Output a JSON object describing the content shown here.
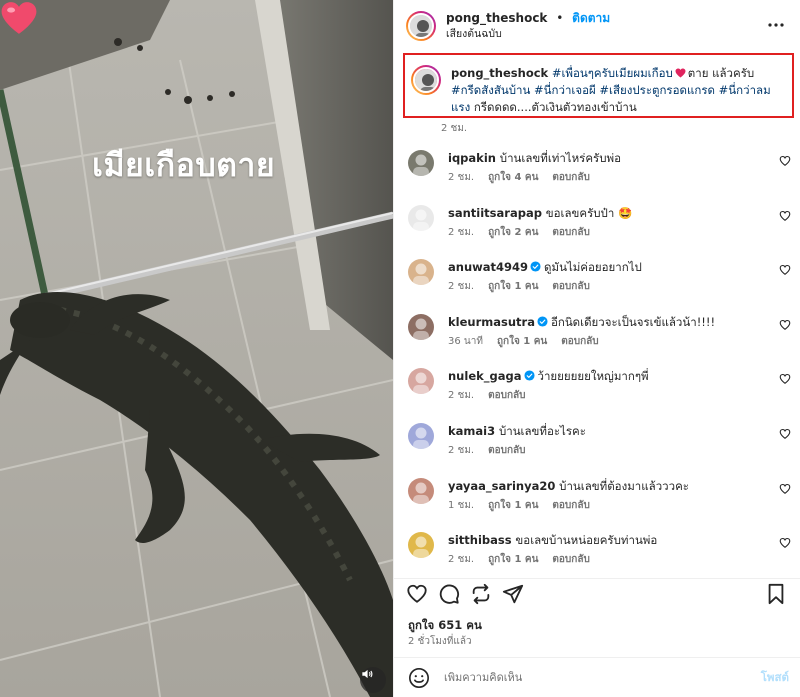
{
  "media": {
    "overlay_text": "เมียเกือบตาย",
    "overlay_emoji": "heart-emoji",
    "sound_icon": "speaker-icon"
  },
  "header": {
    "username": "pong_theshock",
    "separator": "•",
    "follow_label": "ติดตาม",
    "audio_label": "เสียงต้นฉบับ",
    "more_icon": "more-horizontal-icon"
  },
  "caption": {
    "username": "pong_theshock",
    "tag1": "#เพื่อนๆครับเมียผมเกือบ",
    "text1": "ตาย แล้วครับ",
    "tag2": "#กรีดสังสันบ้าน",
    "tag3": "#นี่กว่าเจอผี",
    "tag4": "#เสียงประตูกรอดแกรด",
    "tag5": "#นี่กว่าลมแรง",
    "text2": "กรีดดดด....ตัวเงินตัวทองเข้าบ้าน",
    "time": "2 ชม."
  },
  "comments": [
    {
      "username": "iqpakin",
      "text": "บ้านเลขที่เท่าไหร่ครับพ่อ",
      "verified": false,
      "time": "2 ชม.",
      "likes": "ถูกใจ 4 คน",
      "reply": "ตอบกลับ",
      "avatar_color": "#7a7a6e"
    },
    {
      "username": "santiitsarapap",
      "text": "ขอเลขครับป๋า 🤩",
      "verified": false,
      "time": "2 ชม.",
      "likes": "ถูกใจ 2 คน",
      "reply": "ตอบกลับ",
      "avatar_color": "#e9e9e9"
    },
    {
      "username": "anuwat4949",
      "text": "ดูมันไม่ค่อยอยากไป",
      "verified": true,
      "time": "2 ชม.",
      "likes": "ถูกใจ 1 คน",
      "reply": "ตอบกลับ",
      "avatar_color": "#d9b38c"
    },
    {
      "username": "kleurmasutra",
      "text": "อีกนิดเดียวจะเป็นจรเข้แล้วน้า!!!!",
      "verified": true,
      "time": "36 นาที",
      "likes": "ถูกใจ 1 คน",
      "reply": "ตอบกลับ",
      "avatar_color": "#8d6e63"
    },
    {
      "username": "nulek_gaga",
      "text": "ว้ายยยยยยใหญ่มากๆพี่",
      "verified": true,
      "time": "2 ชม.",
      "likes": "",
      "reply": "ตอบกลับ",
      "avatar_color": "#d7a7a0"
    },
    {
      "username": "kamai3",
      "text": "บ้านเลขที่อะไรคะ",
      "verified": false,
      "time": "2 ชม.",
      "likes": "",
      "reply": "ตอบกลับ",
      "avatar_color": "#9fa8da"
    },
    {
      "username": "yayaa_sarinya20",
      "text": "บ้านเลขที่ต้องมาแล้วววคะ",
      "verified": false,
      "time": "1 ชม.",
      "likes": "ถูกใจ 1 คน",
      "reply": "ตอบกลับ",
      "avatar_color": "#c58b7a"
    },
    {
      "username": "sitthibass",
      "text": "ขอเลขบ้านหน่อยครับท่านพ่อ",
      "verified": false,
      "time": "2 ชม.",
      "likes": "ถูกใจ 1 คน",
      "reply": "ตอบกลับ",
      "avatar_color": "#e0b84a"
    }
  ],
  "actions": {
    "like_icon": "heart-outline-icon",
    "comment_icon": "comment-icon",
    "repost_icon": "repost-icon",
    "share_icon": "send-icon",
    "save_icon": "bookmark-icon"
  },
  "stats": {
    "likes": "ถูกใจ 651 คน",
    "posted": "2 ชั่วโมงที่แล้ว"
  },
  "composer": {
    "emoji_icon": "smiley-icon",
    "placeholder": "เพิ่มความคิดเห็น",
    "post_label": "โพสต์"
  },
  "colors": {
    "follow": "#0095f6",
    "hashtag": "#00376b",
    "highlight_border": "#e02020",
    "verified": "#0095f6",
    "heart": "#ed4956"
  }
}
